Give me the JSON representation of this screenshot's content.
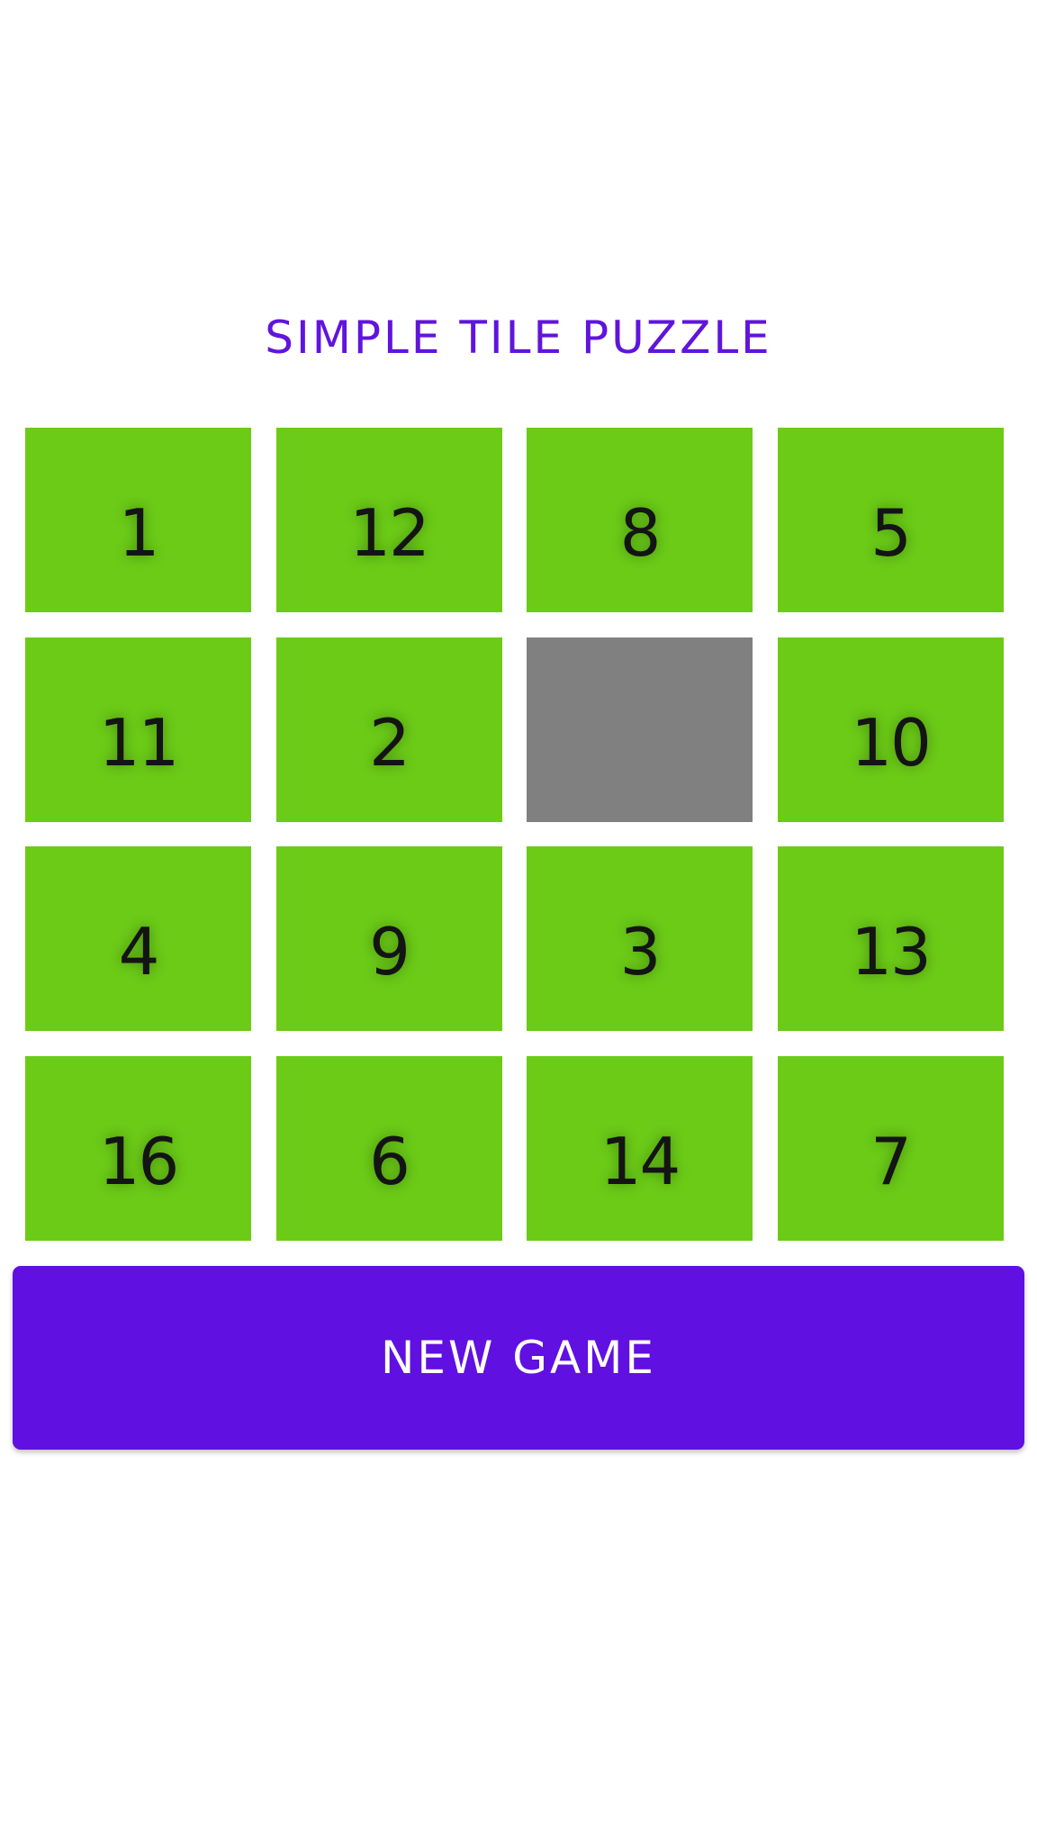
{
  "title": "SIMPLE TILE PUZZLE",
  "board": {
    "rows": 4,
    "columns": 4,
    "tiles": [
      {
        "label": "1",
        "empty": false
      },
      {
        "label": "12",
        "empty": false
      },
      {
        "label": "8",
        "empty": false
      },
      {
        "label": "5",
        "empty": false
      },
      {
        "label": "11",
        "empty": false
      },
      {
        "label": "2",
        "empty": false
      },
      {
        "label": "",
        "empty": true
      },
      {
        "label": "10",
        "empty": false
      },
      {
        "label": "4",
        "empty": false
      },
      {
        "label": "9",
        "empty": false
      },
      {
        "label": "3",
        "empty": false
      },
      {
        "label": "13",
        "empty": false
      },
      {
        "label": "16",
        "empty": false
      },
      {
        "label": "6",
        "empty": false
      },
      {
        "label": "14",
        "empty": false
      },
      {
        "label": "7",
        "empty": false
      }
    ]
  },
  "new_game_label": "NEW GAME",
  "colors": {
    "title": "#6014dc",
    "tile": "#6bcb17",
    "empty_tile": "#808080",
    "button": "#6010e0",
    "button_text": "#ffffff",
    "background": "#ffffff"
  }
}
